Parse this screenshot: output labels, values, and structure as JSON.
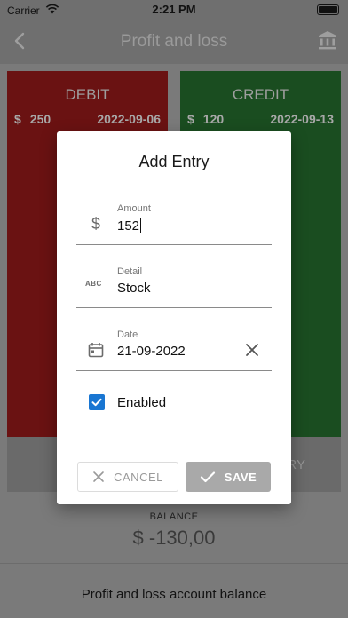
{
  "status_bar": {
    "carrier": "Carrier",
    "time": "2:21 PM"
  },
  "app_bar": {
    "title": "Profit and loss"
  },
  "debit": {
    "heading": "DEBIT",
    "currency": "$",
    "amount": "250",
    "date": "2022-09-06",
    "footer": "+"
  },
  "credit": {
    "heading": "CREDIT",
    "currency": "$",
    "amount": "120",
    "date": "2022-09-13",
    "footer": "RY"
  },
  "balance": {
    "label": "BALANCE",
    "value": "$ -130,00"
  },
  "footer": {
    "text": "Profit and loss account balance"
  },
  "dialog": {
    "title": "Add Entry",
    "amount": {
      "label": "Amount",
      "value": "152",
      "icon": "dollar-icon"
    },
    "detail": {
      "label": "Detail",
      "value": "Stock",
      "icon": "abc-text-icon",
      "icon_text": "ABC"
    },
    "date": {
      "label": "Date",
      "value": "21-09-2022",
      "icon": "calendar-icon"
    },
    "enabled": {
      "label": "Enabled",
      "checked": true
    },
    "cancel_label": "CANCEL",
    "save_label": "SAVE"
  },
  "colors": {
    "accent": "#1976d2",
    "debit": "#d32f2f",
    "credit": "#388e3c"
  }
}
